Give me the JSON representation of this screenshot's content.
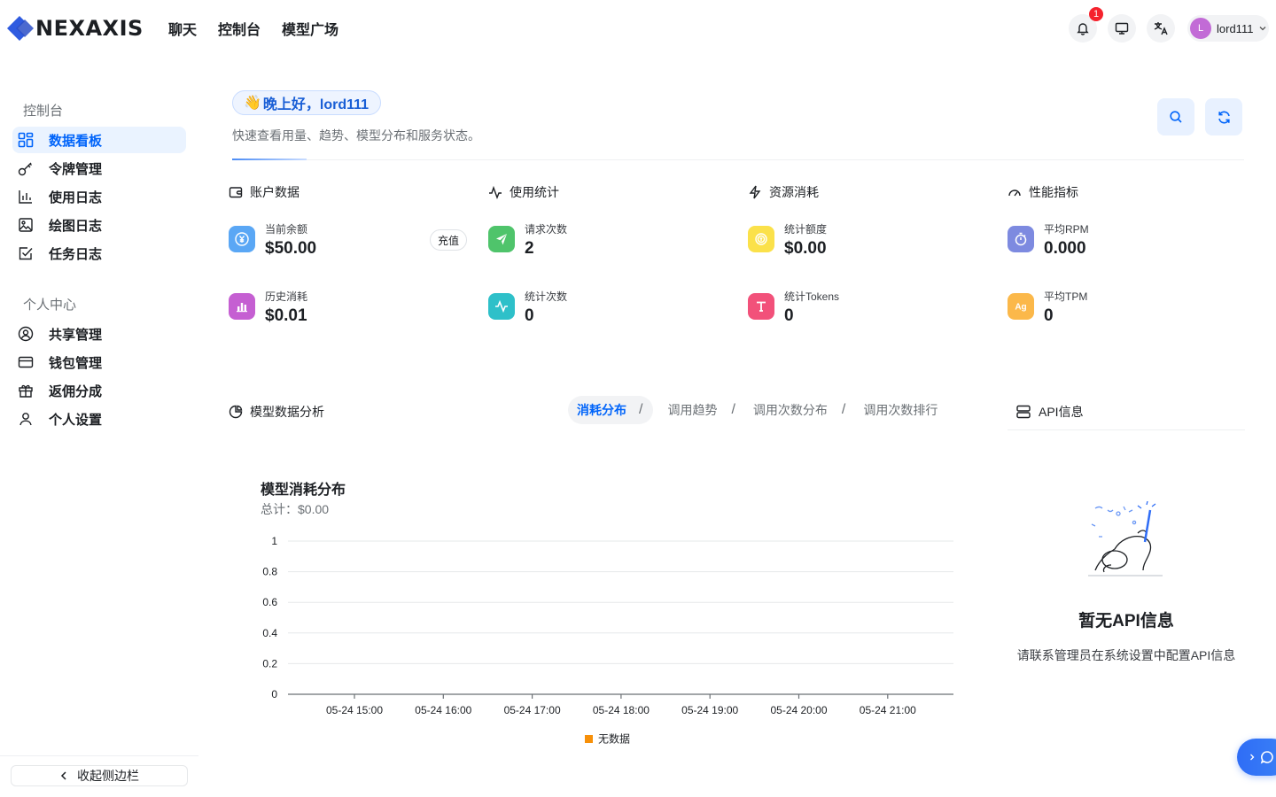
{
  "header": {
    "logo_text": "NEXAXIS",
    "nav": [
      "聊天",
      "控制台",
      "模型广场"
    ],
    "notification_count": "1",
    "user_initial": "L",
    "user_name": "lord111"
  },
  "sidebar": {
    "section_console": "控制台",
    "console_items": [
      {
        "label": "数据看板",
        "icon": "dashboard-icon",
        "active": true
      },
      {
        "label": "令牌管理",
        "icon": "key-icon"
      },
      {
        "label": "使用日志",
        "icon": "bar-chart-icon"
      },
      {
        "label": "绘图日志",
        "icon": "image-icon"
      },
      {
        "label": "任务日志",
        "icon": "checkbox-icon"
      }
    ],
    "section_personal": "个人中心",
    "personal_items": [
      {
        "label": "共享管理",
        "icon": "user-circle-icon"
      },
      {
        "label": "钱包管理",
        "icon": "credit-card-icon"
      },
      {
        "label": "返佣分成",
        "icon": "gift-icon"
      },
      {
        "label": "个人设置",
        "icon": "user-icon"
      }
    ],
    "collapse_label": "收起侧边栏"
  },
  "greeting": {
    "emoji": "👋",
    "text": "晚上好，lord111",
    "subtitle": "快速查看用量、趋势、模型分布和服务状态。"
  },
  "groups": {
    "account": {
      "title": "账户数据",
      "balance_label": "当前余额",
      "balance_value": "$50.00",
      "recharge_label": "充值",
      "history_label": "历史消耗",
      "history_value": "$0.01"
    },
    "usage": {
      "title": "使用统计",
      "requests_label": "请求次数",
      "requests_value": "2",
      "count_label": "统计次数",
      "count_value": "0"
    },
    "resource": {
      "title": "资源消耗",
      "quota_label": "统计额度",
      "quota_value": "$0.00",
      "tokens_label": "统计Tokens",
      "tokens_value": "0"
    },
    "performance": {
      "title": "性能指标",
      "rpm_label": "平均RPM",
      "rpm_value": "0.000",
      "tpm_label": "平均TPM",
      "tpm_value": "0"
    }
  },
  "analysis": {
    "title": "模型数据分析",
    "tabs": [
      "消耗分布",
      "调用趋势",
      "调用次数分布",
      "调用次数排行"
    ],
    "active_tab": 0
  },
  "chart_data": {
    "type": "bar",
    "title": "模型消耗分布",
    "subtitle": "总计：$0.00",
    "categories": [
      "05-24 15:00",
      "05-24 16:00",
      "05-24 17:00",
      "05-24 18:00",
      "05-24 19:00",
      "05-24 20:00",
      "05-24 21:00"
    ],
    "series": [
      {
        "name": "无数据",
        "values": [
          0,
          0,
          0,
          0,
          0,
          0,
          0
        ],
        "color": "#f79009"
      }
    ],
    "yticks": [
      "0",
      "0.2",
      "0.4",
      "0.6",
      "0.8",
      "1"
    ],
    "ylim": [
      0,
      1
    ],
    "grid": true,
    "legend": "bottom"
  },
  "api": {
    "title": "API信息",
    "empty_title": "暂无API信息",
    "empty_desc": "请联系管理员在系统设置中配置API信息"
  },
  "colors": {
    "primary": "#0064fa",
    "balance_icon": "#5aa7f5",
    "history_icon": "#c55fd2",
    "requests_icon": "#4fc46b",
    "count_icon": "#2ec0c9",
    "quota_icon": "#fbe14a",
    "tokens_icon": "#f2517a",
    "rpm_icon": "#7d8ae0",
    "tpm_icon": "#fbb84a"
  }
}
